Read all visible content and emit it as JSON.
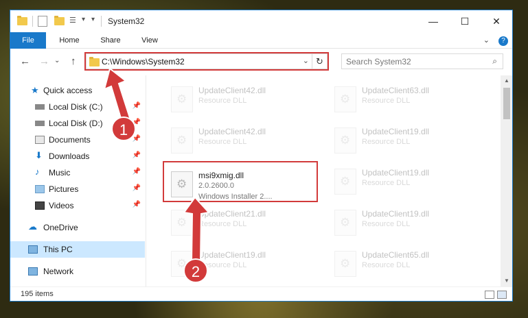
{
  "window": {
    "title": "System32",
    "controls": {
      "minimize": "—",
      "maximize": "☐",
      "close": "✕"
    }
  },
  "ribbon": {
    "tabs": [
      "File",
      "Home",
      "Share",
      "View"
    ],
    "expand_label": "⌄",
    "help_label": "?"
  },
  "address_bar": {
    "path": "C:\\Windows\\System32",
    "dropdown_glyph": "⌄",
    "refresh_glyph": "↻"
  },
  "nav_buttons": {
    "back": "←",
    "forward": "→",
    "dropdown": "⌄",
    "up": "↑"
  },
  "search": {
    "placeholder": "Search System32",
    "icon": "⌕"
  },
  "nav_pane": {
    "items": [
      {
        "label": "Quick access",
        "icon": "star-icon",
        "pinned": false
      },
      {
        "label": "Local Disk (C:)",
        "icon": "drive-icon",
        "pinned": true
      },
      {
        "label": "Local Disk (D:)",
        "icon": "drive-icon",
        "pinned": true
      },
      {
        "label": "Documents",
        "icon": "documents-icon",
        "pinned": true
      },
      {
        "label": "Downloads",
        "icon": "downloads-icon",
        "pinned": true
      },
      {
        "label": "Music",
        "icon": "music-icon",
        "pinned": true
      },
      {
        "label": "Pictures",
        "icon": "pictures-icon",
        "pinned": true
      },
      {
        "label": "Videos",
        "icon": "videos-icon",
        "pinned": true
      },
      {
        "label": "OneDrive",
        "icon": "cloud-icon",
        "pinned": false
      },
      {
        "label": "This PC",
        "icon": "computer-icon",
        "pinned": false,
        "selected": true
      },
      {
        "label": "Network",
        "icon": "network-icon",
        "pinned": false
      }
    ],
    "pin_glyph": "📌"
  },
  "files": [
    {
      "name": "UpdateClient42.dll",
      "type": "Resource DLL"
    },
    {
      "name": "UpdateClient63.dll",
      "type": "Resource DLL"
    },
    {
      "name": "UpdateClient42.dll",
      "type": "Resource DLL"
    },
    {
      "name": "UpdateClient19.dll",
      "type": "Resource DLL"
    },
    {
      "name": "msi9xmig.dll",
      "version": "2.0.2600.0",
      "type": "Windows Installer 2...."
    },
    {
      "name": "UpdateClient19.dll",
      "type": "Resource DLL"
    },
    {
      "name": "UpdateClient21.dll",
      "type": "Resource DLL"
    },
    {
      "name": "UpdateClient19.dll",
      "type": "Resource DLL"
    },
    {
      "name": "UpdateClient19.dll",
      "type": "Resource DLL"
    },
    {
      "name": "UpdateClient65.dll",
      "type": "Resource DLL"
    }
  ],
  "status_bar": {
    "item_count": "195 items"
  },
  "annotations": {
    "badge_1": "1",
    "badge_2": "2",
    "highlight_color": "#d23a3a"
  },
  "colors": {
    "accent": "#1979ca",
    "selection": "#cce8ff"
  }
}
